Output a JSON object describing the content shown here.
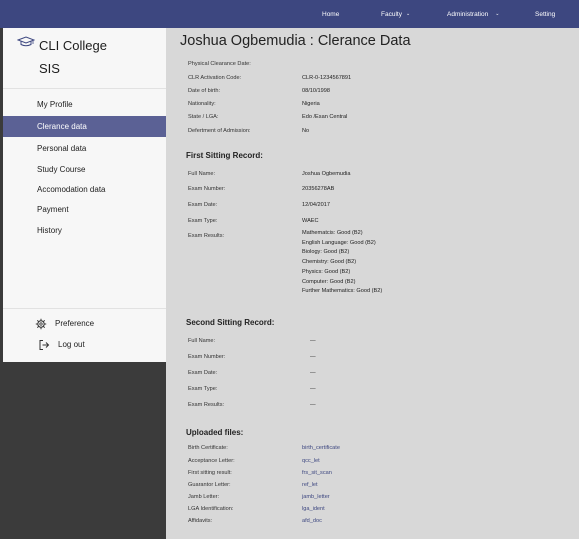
{
  "topnav": {
    "home": "Home",
    "faculty": "Faculty",
    "administration": "Administration",
    "setting": "Setting"
  },
  "brand": {
    "line1": "CLI College",
    "line2": "SIS",
    "icon": "graduation-cap-icon"
  },
  "sidebar": {
    "items": [
      {
        "label": "My Profile"
      },
      {
        "label": "Clerance data"
      },
      {
        "label": "Personal data"
      },
      {
        "label": "Study Course"
      },
      {
        "label": "Accomodation data"
      },
      {
        "label": "Payment"
      },
      {
        "label": "History"
      }
    ],
    "active_index": 1,
    "preference": "Preference",
    "logout": "Log out"
  },
  "main": {
    "title": "Joshua Ogbemudia : Clerance Data",
    "clearance": [
      {
        "label": "Physical Clearance Date:",
        "value": ""
      },
      {
        "label": "CLR Activation Code:",
        "value": "CLR-0-1234567891"
      },
      {
        "label": "Date of birth:",
        "value": "08/10/1998"
      },
      {
        "label": "Nationality:",
        "value": "Nigeria"
      },
      {
        "label": "State / LGA:",
        "value": "Edo /Esan Central"
      },
      {
        "label": "Defertment of Admission:",
        "value": "No"
      }
    ],
    "first_sitting": {
      "heading": "First Sitting Record:",
      "rows": [
        {
          "label": "Full Name:",
          "value": "Joshua Ogbemudia"
        },
        {
          "label": "Exam Number:",
          "value": "20356278AB"
        },
        {
          "label": "Exam Date:",
          "value": "12/04/2017"
        },
        {
          "label": "Exam Type:",
          "value": "WAEC"
        },
        {
          "label": "Exam Results:",
          "value": ""
        }
      ],
      "results": [
        "Mathematcis: Good (B2)",
        "English Language: Good (B2)",
        "Biology: Good (B2)",
        "Chemistry: Good (B2)",
        "Physics: Good (B2)",
        "Computer: Good (B2)",
        "Further Mathematics: Good (B2)"
      ]
    },
    "second_sitting": {
      "heading": "Second Sitting Record:",
      "rows": [
        {
          "label": "Full Name:",
          "value": "—"
        },
        {
          "label": "Exam Number:",
          "value": "—"
        },
        {
          "label": "Exam Date:",
          "value": "—"
        },
        {
          "label": "Exam Type:",
          "value": "—"
        },
        {
          "label": "Exam Results:",
          "value": "—"
        }
      ]
    },
    "uploads": {
      "heading": "Uploaded files:",
      "rows": [
        {
          "label": "Birth Certificate:",
          "value": "birth_certificate"
        },
        {
          "label": "Acceptance Letter:",
          "value": "qcc_let"
        },
        {
          "label": "First sitting result:",
          "value": "frs_sit_scan"
        },
        {
          "label": "Guarantor Letter:",
          "value": "ref_let"
        },
        {
          "label": "Jamb Letter:",
          "value": "jamb_letter"
        },
        {
          "label": "LGA Identification:",
          "value": "lga_ident"
        },
        {
          "label": "Affidavits:",
          "value": "afd_doc"
        }
      ]
    }
  },
  "colors": {
    "topbar": "#3d4780",
    "active_item": "#5b6195",
    "main_bg": "#d8d8d8",
    "sidebar_bg": "#f7f7f7",
    "outer_bg": "#3b3b3b",
    "link": "#3d4780"
  }
}
